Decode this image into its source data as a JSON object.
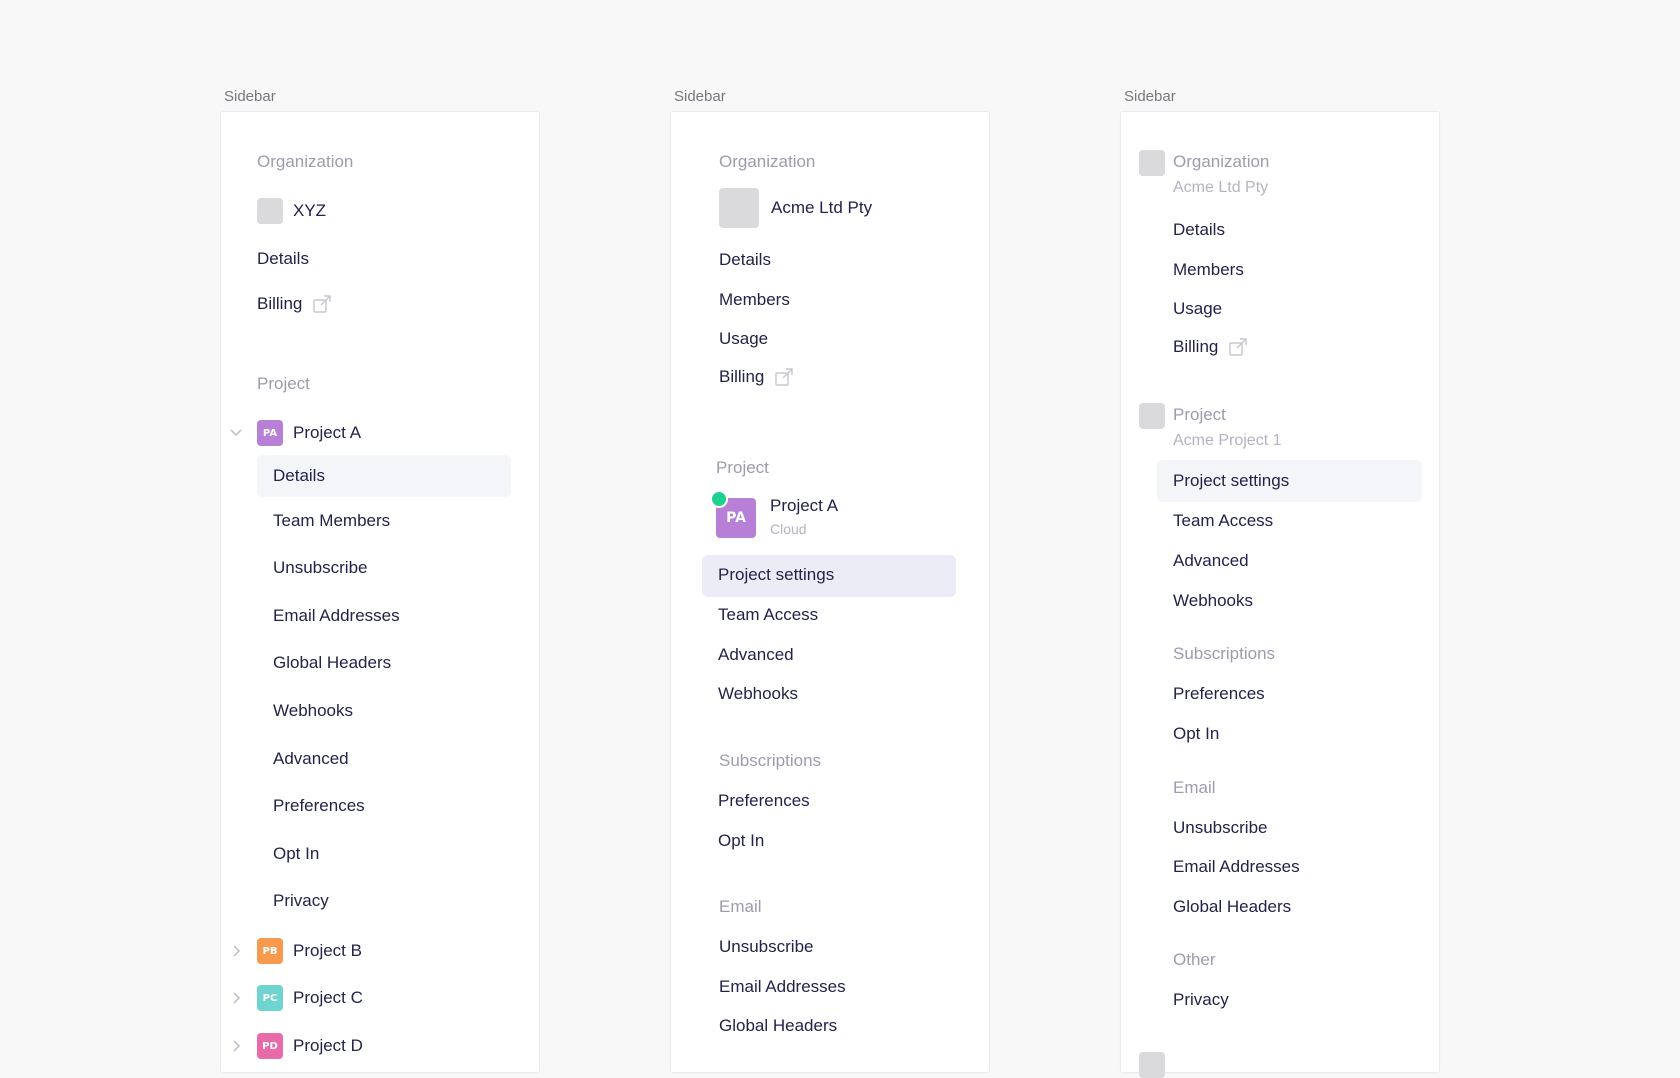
{
  "frames": [
    {
      "label": "Sidebar",
      "org": {
        "title": "Organization",
        "name": "XYZ",
        "items": [
          "Details",
          "Billing"
        ]
      },
      "project": {
        "title": "Project",
        "active": {
          "name": "Project A",
          "badge": "PA",
          "badge_color": "#b77fd6"
        },
        "items": [
          "Details",
          "Team Members",
          "Unsubscribe",
          "Email Addresses",
          "Global Headers",
          "Webhooks",
          "Advanced",
          "Preferences",
          "Opt In",
          "Privacy"
        ],
        "others": [
          {
            "name": "Project B",
            "badge": "PB",
            "badge_color": "#f79a4e"
          },
          {
            "name": "Project C",
            "badge": "PC",
            "badge_color": "#6fd3cf"
          },
          {
            "name": "Project D",
            "badge": "PD",
            "badge_color": "#e96aa8"
          }
        ]
      }
    },
    {
      "label": "Sidebar",
      "org": {
        "title": "Organization",
        "name": "Acme Ltd Pty",
        "items": [
          "Details",
          "Members",
          "Usage",
          "Billing"
        ]
      },
      "project": {
        "title": "Project",
        "name": "Project A",
        "subtitle": "Cloud",
        "badge": "PA",
        "badge_color": "#b77fd6",
        "status_color": "#1fd18f",
        "items": [
          "Project settings",
          "Team Access",
          "Advanced",
          "Webhooks"
        ]
      },
      "subscriptions": {
        "title": "Subscriptions",
        "items": [
          "Preferences",
          "Opt In"
        ]
      },
      "email": {
        "title": "Email",
        "items": [
          "Unsubscribe",
          "Email Addresses",
          "Global Headers"
        ]
      }
    },
    {
      "label": "Sidebar",
      "org": {
        "title": "Organization",
        "name": "Acme Ltd Pty",
        "items": [
          "Details",
          "Members",
          "Usage",
          "Billing"
        ]
      },
      "project": {
        "title": "Project",
        "name": "Acme Project 1",
        "items": [
          "Project settings",
          "Team Access",
          "Advanced",
          "Webhooks"
        ]
      },
      "subscriptions": {
        "title": "Subscriptions",
        "items": [
          "Preferences",
          "Opt In"
        ]
      },
      "email": {
        "title": "Email",
        "items": [
          "Unsubscribe",
          "Email Addresses",
          "Global Headers"
        ]
      },
      "other": {
        "title": "Other",
        "items": [
          "Privacy"
        ]
      }
    }
  ],
  "icons": {
    "external": "external-link-icon",
    "chevron_down": "chevron-down-icon",
    "chevron_right": "chevron-right-icon"
  },
  "colors": {
    "active_bg_light": "#f4f5f9",
    "active_bg": "#ececf6",
    "text": "#22234a",
    "muted": "#9c9cae"
  }
}
